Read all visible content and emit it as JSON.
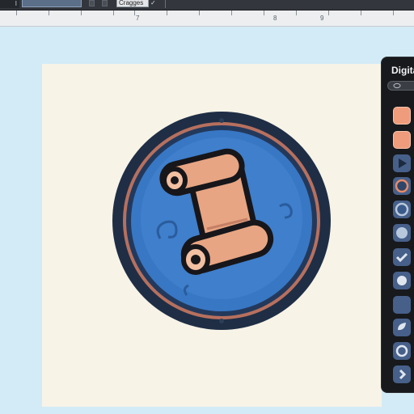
{
  "toolbar": {
    "corner_label": "I",
    "font_select_value": "Cragges",
    "check_glyph": "✓"
  },
  "ruler": {
    "labels": [
      "7",
      "8",
      "9"
    ]
  },
  "panel": {
    "title": "Digita",
    "search_icon": "search-icon",
    "items": [
      {
        "name": "swatch-peach-1",
        "icon": "filled-square"
      },
      {
        "name": "swatch-peach-2",
        "icon": "filled-square"
      },
      {
        "name": "play",
        "icon": "play-icon"
      },
      {
        "name": "ring-orange",
        "icon": "ring-icon"
      },
      {
        "name": "ring-blue",
        "icon": "ring-icon"
      },
      {
        "name": "dot-blue",
        "icon": "dot-icon"
      },
      {
        "name": "check",
        "icon": "check-icon"
      },
      {
        "name": "dot-small",
        "icon": "dot-icon"
      },
      {
        "name": "blank",
        "icon": "blank"
      },
      {
        "name": "leaf",
        "icon": "leaf-icon"
      },
      {
        "name": "ring-small",
        "icon": "ring-icon"
      },
      {
        "name": "chevron",
        "icon": "chevron-right-icon"
      }
    ]
  },
  "colors": {
    "badge_blue": "#3877c4",
    "badge_rim": "#1f2e45",
    "badge_ring": "#b7705e",
    "scroll": "#e7a583",
    "artboard": "#f7f3e7",
    "background": "#d3ebf6"
  }
}
